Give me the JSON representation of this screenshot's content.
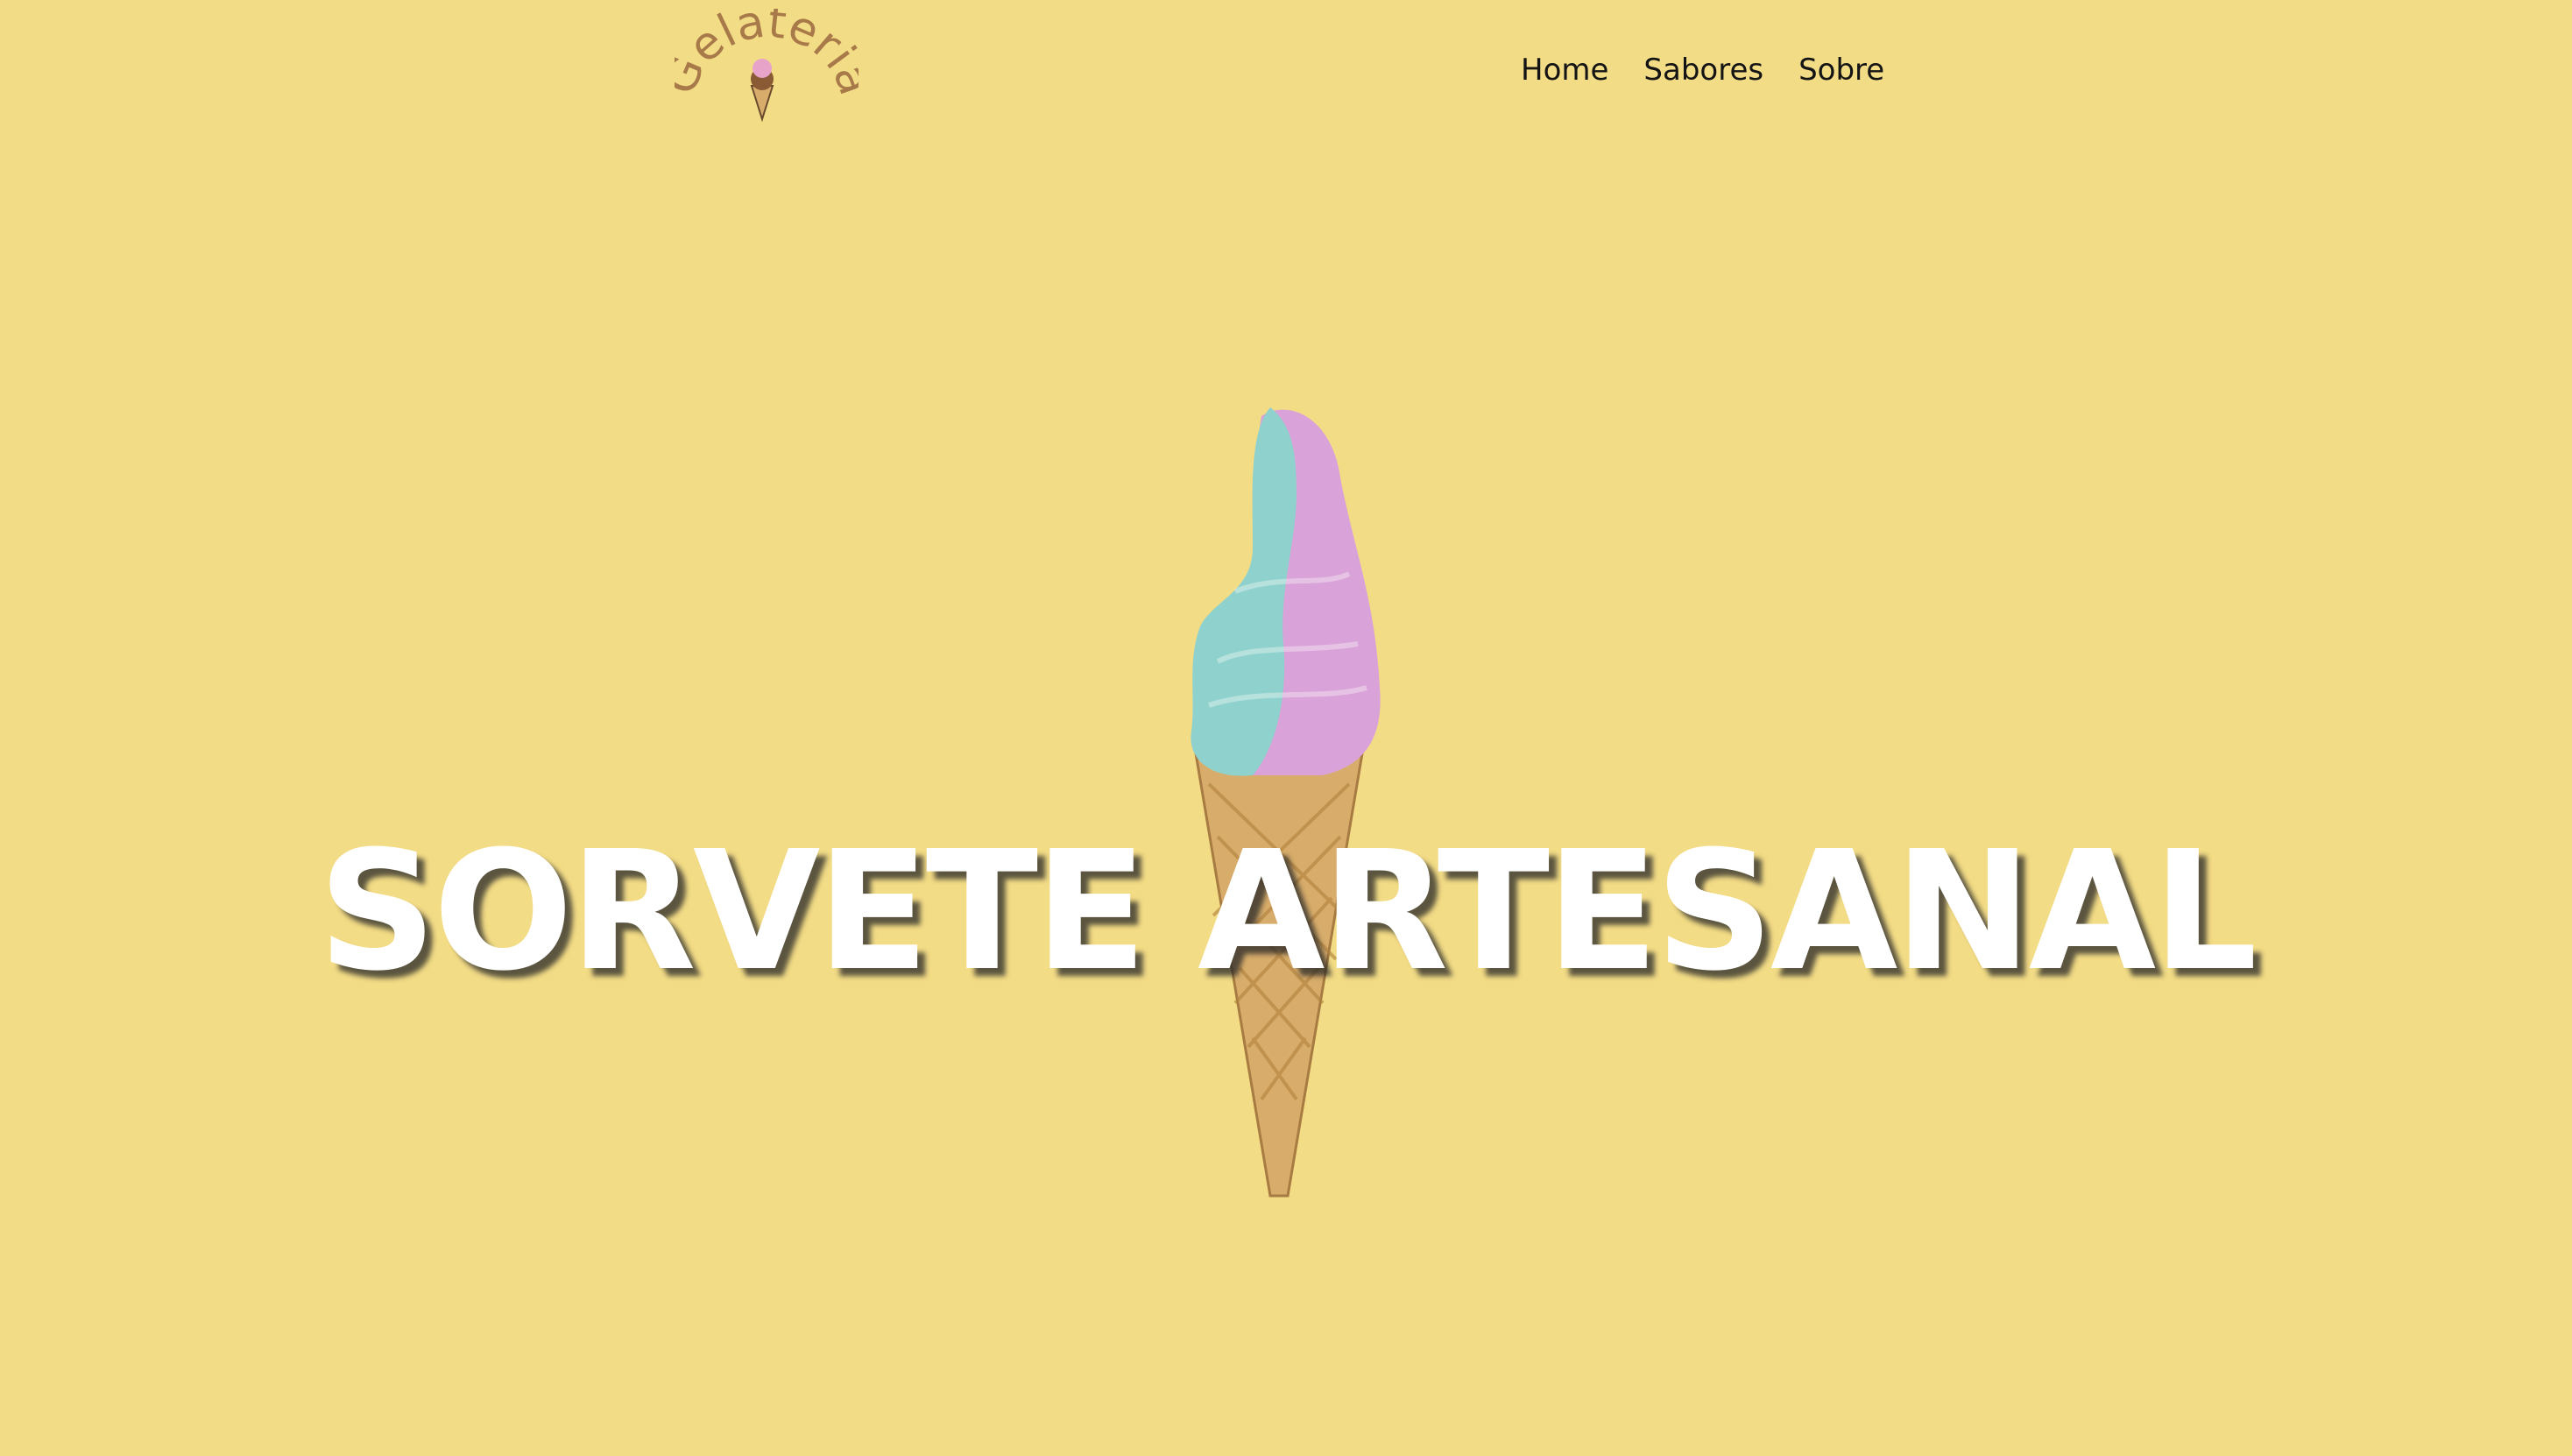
{
  "brand": {
    "logo_text": "Gelateria"
  },
  "nav": {
    "items": [
      {
        "label": "Home"
      },
      {
        "label": "Sabores"
      },
      {
        "label": "Sobre"
      }
    ]
  },
  "hero": {
    "title": "SORVETE ARTESANAL",
    "image": "ice-cream-cone-icon"
  },
  "colors": {
    "background": "#f3dc86",
    "logo_text": "#a87a4a",
    "nav_text": "#141414",
    "title_text": "#ffffff",
    "scoop_teal": "#8fd1cc",
    "scoop_pink": "#d9a2d8",
    "cone": "#d8ad6b"
  }
}
